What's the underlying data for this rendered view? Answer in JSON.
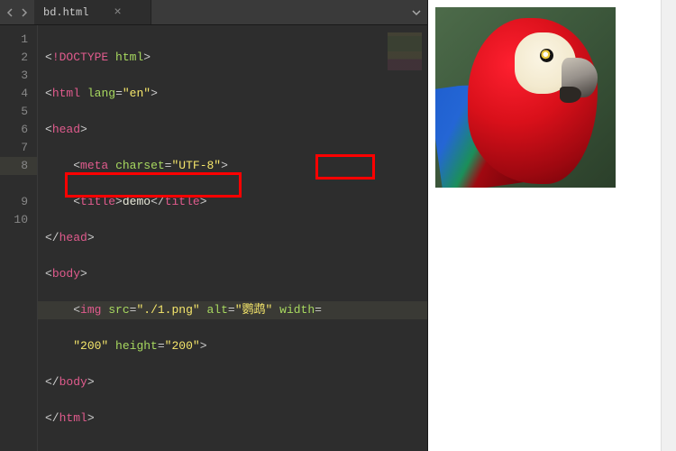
{
  "tab": {
    "filename": "bd.html",
    "close_glyph": "×"
  },
  "gutter": [
    "1",
    "2",
    "3",
    "4",
    "5",
    "6",
    "7",
    "8",
    "",
    "9",
    "10"
  ],
  "code": {
    "l1": {
      "doctype": "!DOCTYPE",
      "html": "html"
    },
    "l2": {
      "tag": "html",
      "attr": "lang",
      "val": "\"en\""
    },
    "l3": {
      "tag": "head"
    },
    "l4": {
      "tag": "meta",
      "attr": "charset",
      "val": "\"UTF-8\""
    },
    "l5": {
      "tag": "title",
      "text": "demo",
      "ctag": "title"
    },
    "l6": {
      "ctag": "head"
    },
    "l7": {
      "tag": "body"
    },
    "l8a": {
      "tag": "img",
      "attr_src": "src",
      "val_src": "\"./1.png\"",
      "attr_alt": "alt",
      "val_alt": "\"鹦鹉\"",
      "attr_w": "width"
    },
    "l8b": {
      "val_w": "\"200\"",
      "attr_h": "height",
      "val_h": "\"200\""
    },
    "l9": {
      "ctag": "body"
    },
    "l10": {
      "ctag": "html"
    }
  },
  "image": {
    "alt": "鹦鹉"
  }
}
